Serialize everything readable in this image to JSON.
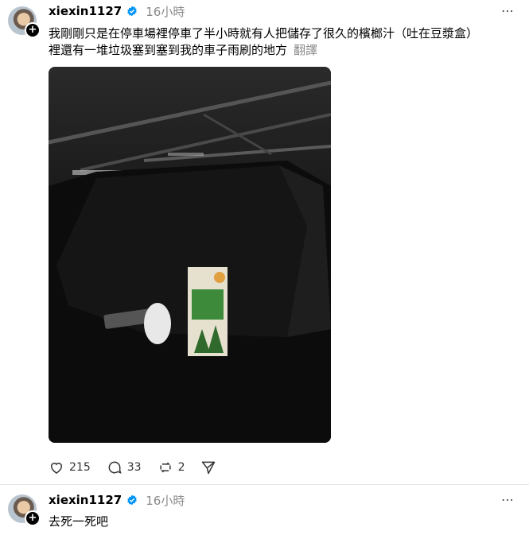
{
  "post1": {
    "username": "xiexin1127",
    "time": "16小時",
    "text_line1": "我剛剛只是在停車場裡停車了半小時就有人把儲存了很久的檳榔汁（吐在豆漿盒）",
    "text_line2": "裡還有一堆垃圾塞到塞到我的車子雨刷的地方",
    "translate": "翻譯",
    "likes": "215",
    "comments": "33",
    "reposts": "2"
  },
  "post2": {
    "username": "xiexin1127",
    "time": "16小時",
    "text": "去死一死吧"
  },
  "more_label": "⋯",
  "colors": {
    "verified": "#0095f6",
    "muted": "#8a8a8a"
  }
}
